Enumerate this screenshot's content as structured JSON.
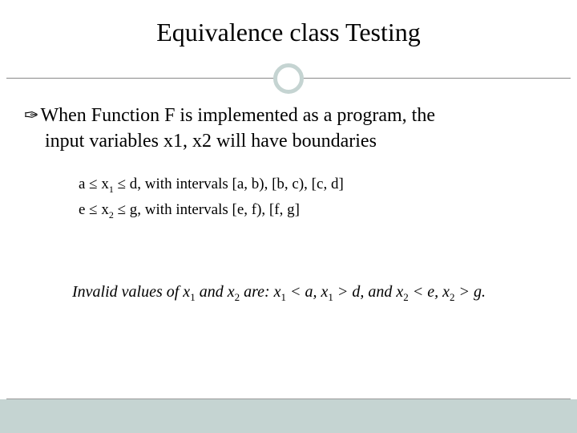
{
  "slide": {
    "title": "Equivalence class Testing",
    "bullet_text": "When Function F is implemented as a program, the",
    "continuation": "input variables x1, x2 will have boundaries",
    "math_line1_prefix": "a ≤ x",
    "math_line1_sub1": "1",
    "math_line1_mid": " ≤ d, with intervals [a, b), [b, c), [c, d]",
    "math_line2_prefix": "e ≤ x",
    "math_line2_sub1": "2",
    "math_line2_mid": " ≤ g, with intervals [e, f), [f, g]",
    "invalid_prefix": "Invalid values of x",
    "invalid_sub1": "1",
    "invalid_mid1": " and x",
    "invalid_sub2": "2",
    "invalid_mid2": " are: x",
    "invalid_sub3": "1",
    "invalid_mid3": " < a, x",
    "invalid_sub4": "1",
    "invalid_mid4": " > d, and x",
    "invalid_sub5": "2",
    "invalid_mid5": " < e, x",
    "invalid_sub6": "2",
    "invalid_mid6": " > g."
  }
}
